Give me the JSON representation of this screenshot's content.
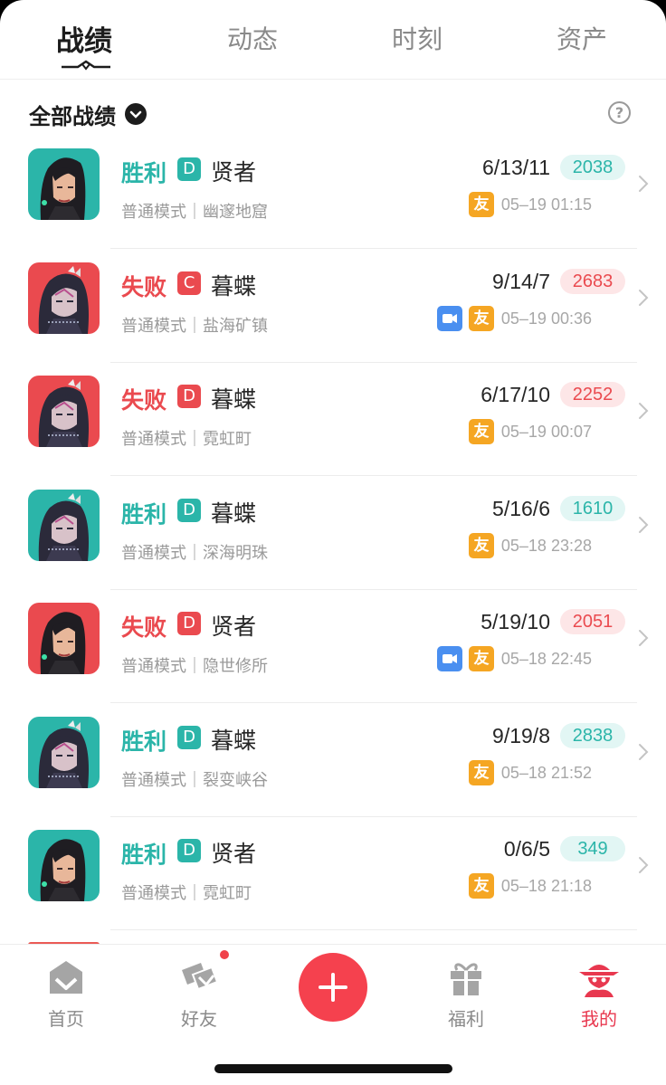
{
  "tabs": [
    {
      "label": "战绩",
      "active": true
    },
    {
      "label": "动态",
      "active": false
    },
    {
      "label": "时刻",
      "active": false
    },
    {
      "label": "资产",
      "active": false
    }
  ],
  "filter": {
    "label": "全部战绩",
    "icon": "chevron-down-icon",
    "help_icon": "question-icon",
    "help_glyph": "?"
  },
  "colors": {
    "win": "#2bb5a9",
    "loss": "#ea4a4f",
    "win_score_bg": "#e2f6f4",
    "loss_score_bg": "#fde6e7",
    "friend_badge": "#f5a623",
    "video_badge": "#4a8ff0",
    "accent": "#f5414e"
  },
  "matches": [
    {
      "result": "胜利",
      "outcome": "win",
      "grade": "D",
      "hero": "贤者",
      "mode": "普通模式｜幽邃地窟",
      "kda": "6/13/11",
      "score": "2038",
      "friend_badge": "友",
      "video": false,
      "time": "05–19 01:15",
      "avatar": "sage"
    },
    {
      "result": "失败",
      "outcome": "loss",
      "grade": "C",
      "hero": "暮蝶",
      "mode": "普通模式｜盐海矿镇",
      "kda": "9/14/7",
      "score": "2683",
      "friend_badge": "友",
      "video": true,
      "time": "05–19 00:36",
      "avatar": "butterfly"
    },
    {
      "result": "失败",
      "outcome": "loss",
      "grade": "D",
      "hero": "暮蝶",
      "mode": "普通模式｜霓虹町",
      "kda": "6/17/10",
      "score": "2252",
      "friend_badge": "友",
      "video": false,
      "time": "05–19 00:07",
      "avatar": "butterfly"
    },
    {
      "result": "胜利",
      "outcome": "win",
      "grade": "D",
      "hero": "暮蝶",
      "mode": "普通模式｜深海明珠",
      "kda": "5/16/6",
      "score": "1610",
      "friend_badge": "友",
      "video": false,
      "time": "05–18 23:28",
      "avatar": "butterfly"
    },
    {
      "result": "失败",
      "outcome": "loss",
      "grade": "D",
      "hero": "贤者",
      "mode": "普通模式｜隐世修所",
      "kda": "5/19/10",
      "score": "2051",
      "friend_badge": "友",
      "video": true,
      "time": "05–18 22:45",
      "avatar": "sage"
    },
    {
      "result": "胜利",
      "outcome": "win",
      "grade": "D",
      "hero": "暮蝶",
      "mode": "普通模式｜裂变峡谷",
      "kda": "9/19/8",
      "score": "2838",
      "friend_badge": "友",
      "video": false,
      "time": "05–18 21:52",
      "avatar": "butterfly"
    },
    {
      "result": "胜利",
      "outcome": "win",
      "grade": "D",
      "hero": "贤者",
      "mode": "普通模式｜霓虹町",
      "kda": "0/6/5",
      "score": "349",
      "friend_badge": "友",
      "video": false,
      "time": "05–18 21:18",
      "avatar": "sage"
    }
  ],
  "bottom_nav": [
    {
      "label": "首页",
      "icon": "home-icon",
      "active": false
    },
    {
      "label": "好友",
      "icon": "friends-icon",
      "active": false,
      "notification_dot": true
    },
    {
      "label": "",
      "icon": "plus-icon",
      "active": false
    },
    {
      "label": "福利",
      "icon": "gift-icon",
      "active": false
    },
    {
      "label": "我的",
      "icon": "profile-icon",
      "active": true
    }
  ]
}
